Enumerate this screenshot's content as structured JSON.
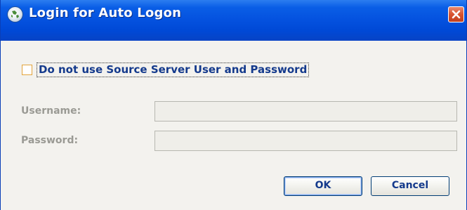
{
  "window": {
    "title": "Login for Auto Logon",
    "close_symbol": "✕"
  },
  "options": {
    "use_source_checkbox_label": "Do not use Source Server User and Password",
    "use_source_checked": false
  },
  "form": {
    "username_label": "Username:",
    "username_value": "",
    "password_label": "Password:",
    "password_value": ""
  },
  "buttons": {
    "ok_label": "OK",
    "cancel_label": "Cancel"
  },
  "colors": {
    "titlebar": "#0553e0",
    "label_blue": "#143a8c",
    "disabled_label": "#9a9a94",
    "checkbox_border": "#e2a43c",
    "close_red": "#d8532f"
  }
}
